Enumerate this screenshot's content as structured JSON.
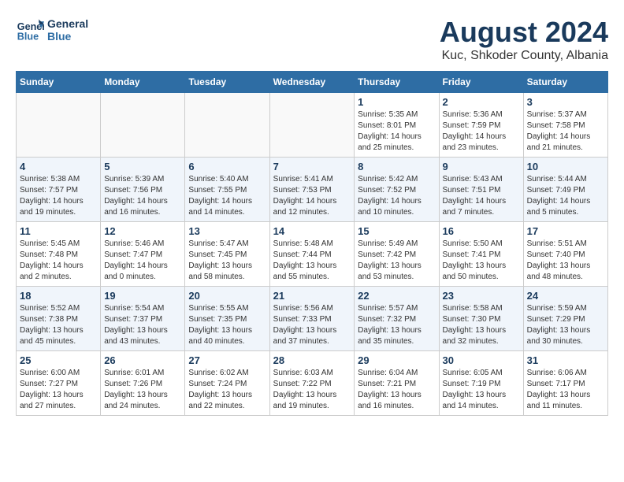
{
  "header": {
    "logo_line1": "General",
    "logo_line2": "Blue",
    "month": "August 2024",
    "location": "Kuc, Shkoder County, Albania"
  },
  "weekdays": [
    "Sunday",
    "Monday",
    "Tuesday",
    "Wednesday",
    "Thursday",
    "Friday",
    "Saturday"
  ],
  "weeks": [
    [
      {
        "day": "",
        "info": ""
      },
      {
        "day": "",
        "info": ""
      },
      {
        "day": "",
        "info": ""
      },
      {
        "day": "",
        "info": ""
      },
      {
        "day": "1",
        "info": "Sunrise: 5:35 AM\nSunset: 8:01 PM\nDaylight: 14 hours\nand 25 minutes."
      },
      {
        "day": "2",
        "info": "Sunrise: 5:36 AM\nSunset: 7:59 PM\nDaylight: 14 hours\nand 23 minutes."
      },
      {
        "day": "3",
        "info": "Sunrise: 5:37 AM\nSunset: 7:58 PM\nDaylight: 14 hours\nand 21 minutes."
      }
    ],
    [
      {
        "day": "4",
        "info": "Sunrise: 5:38 AM\nSunset: 7:57 PM\nDaylight: 14 hours\nand 19 minutes."
      },
      {
        "day": "5",
        "info": "Sunrise: 5:39 AM\nSunset: 7:56 PM\nDaylight: 14 hours\nand 16 minutes."
      },
      {
        "day": "6",
        "info": "Sunrise: 5:40 AM\nSunset: 7:55 PM\nDaylight: 14 hours\nand 14 minutes."
      },
      {
        "day": "7",
        "info": "Sunrise: 5:41 AM\nSunset: 7:53 PM\nDaylight: 14 hours\nand 12 minutes."
      },
      {
        "day": "8",
        "info": "Sunrise: 5:42 AM\nSunset: 7:52 PM\nDaylight: 14 hours\nand 10 minutes."
      },
      {
        "day": "9",
        "info": "Sunrise: 5:43 AM\nSunset: 7:51 PM\nDaylight: 14 hours\nand 7 minutes."
      },
      {
        "day": "10",
        "info": "Sunrise: 5:44 AM\nSunset: 7:49 PM\nDaylight: 14 hours\nand 5 minutes."
      }
    ],
    [
      {
        "day": "11",
        "info": "Sunrise: 5:45 AM\nSunset: 7:48 PM\nDaylight: 14 hours\nand 2 minutes."
      },
      {
        "day": "12",
        "info": "Sunrise: 5:46 AM\nSunset: 7:47 PM\nDaylight: 14 hours\nand 0 minutes."
      },
      {
        "day": "13",
        "info": "Sunrise: 5:47 AM\nSunset: 7:45 PM\nDaylight: 13 hours\nand 58 minutes."
      },
      {
        "day": "14",
        "info": "Sunrise: 5:48 AM\nSunset: 7:44 PM\nDaylight: 13 hours\nand 55 minutes."
      },
      {
        "day": "15",
        "info": "Sunrise: 5:49 AM\nSunset: 7:42 PM\nDaylight: 13 hours\nand 53 minutes."
      },
      {
        "day": "16",
        "info": "Sunrise: 5:50 AM\nSunset: 7:41 PM\nDaylight: 13 hours\nand 50 minutes."
      },
      {
        "day": "17",
        "info": "Sunrise: 5:51 AM\nSunset: 7:40 PM\nDaylight: 13 hours\nand 48 minutes."
      }
    ],
    [
      {
        "day": "18",
        "info": "Sunrise: 5:52 AM\nSunset: 7:38 PM\nDaylight: 13 hours\nand 45 minutes."
      },
      {
        "day": "19",
        "info": "Sunrise: 5:54 AM\nSunset: 7:37 PM\nDaylight: 13 hours\nand 43 minutes."
      },
      {
        "day": "20",
        "info": "Sunrise: 5:55 AM\nSunset: 7:35 PM\nDaylight: 13 hours\nand 40 minutes."
      },
      {
        "day": "21",
        "info": "Sunrise: 5:56 AM\nSunset: 7:33 PM\nDaylight: 13 hours\nand 37 minutes."
      },
      {
        "day": "22",
        "info": "Sunrise: 5:57 AM\nSunset: 7:32 PM\nDaylight: 13 hours\nand 35 minutes."
      },
      {
        "day": "23",
        "info": "Sunrise: 5:58 AM\nSunset: 7:30 PM\nDaylight: 13 hours\nand 32 minutes."
      },
      {
        "day": "24",
        "info": "Sunrise: 5:59 AM\nSunset: 7:29 PM\nDaylight: 13 hours\nand 30 minutes."
      }
    ],
    [
      {
        "day": "25",
        "info": "Sunrise: 6:00 AM\nSunset: 7:27 PM\nDaylight: 13 hours\nand 27 minutes."
      },
      {
        "day": "26",
        "info": "Sunrise: 6:01 AM\nSunset: 7:26 PM\nDaylight: 13 hours\nand 24 minutes."
      },
      {
        "day": "27",
        "info": "Sunrise: 6:02 AM\nSunset: 7:24 PM\nDaylight: 13 hours\nand 22 minutes."
      },
      {
        "day": "28",
        "info": "Sunrise: 6:03 AM\nSunset: 7:22 PM\nDaylight: 13 hours\nand 19 minutes."
      },
      {
        "day": "29",
        "info": "Sunrise: 6:04 AM\nSunset: 7:21 PM\nDaylight: 13 hours\nand 16 minutes."
      },
      {
        "day": "30",
        "info": "Sunrise: 6:05 AM\nSunset: 7:19 PM\nDaylight: 13 hours\nand 14 minutes."
      },
      {
        "day": "31",
        "info": "Sunrise: 6:06 AM\nSunset: 7:17 PM\nDaylight: 13 hours\nand 11 minutes."
      }
    ]
  ]
}
